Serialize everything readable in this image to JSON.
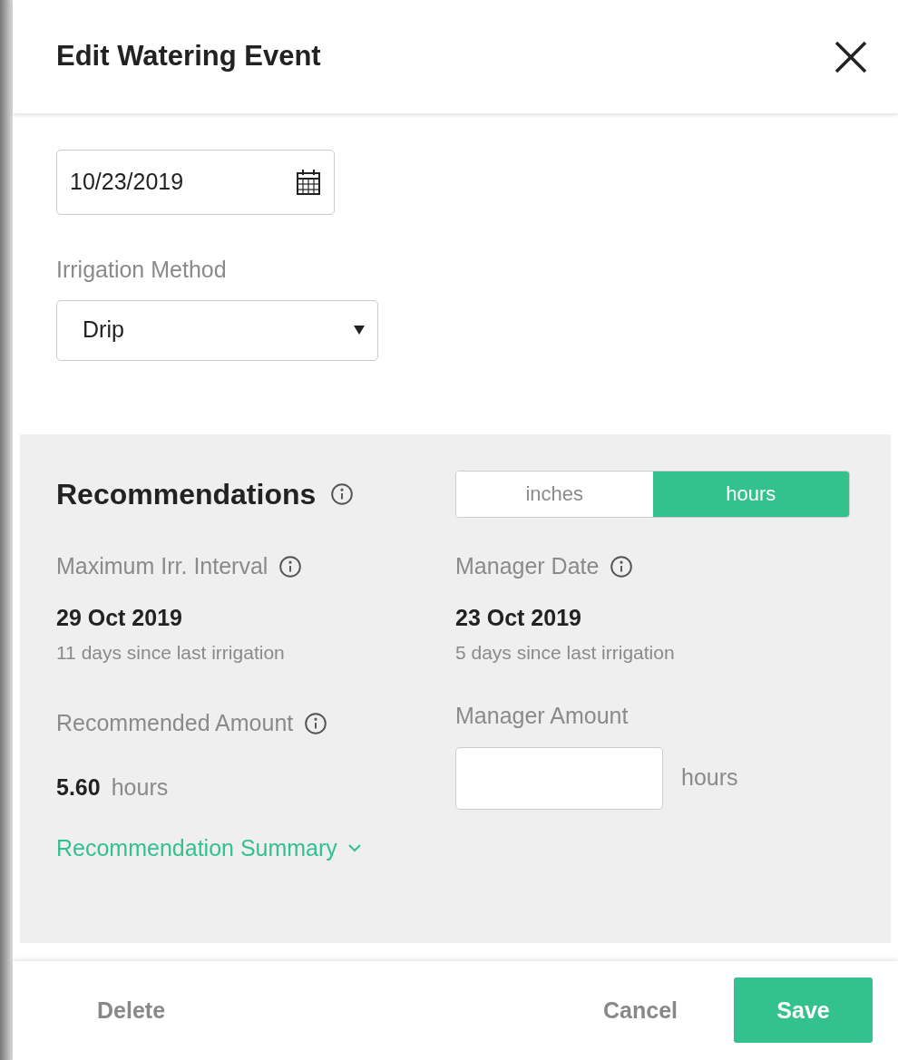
{
  "header": {
    "title": "Edit Watering Event"
  },
  "date_field": {
    "value": "10/23/2019"
  },
  "irrigation_method": {
    "label": "Irrigation Method",
    "value": "Drip"
  },
  "recommendations": {
    "title": "Recommendations",
    "unit_toggle": [
      {
        "label": "inches",
        "selected": false
      },
      {
        "label": "hours",
        "selected": true
      }
    ],
    "max_interval": {
      "label": "Maximum Irr. Interval",
      "date": "29 Oct 2019",
      "note": "11 days since last irrigation"
    },
    "manager_date": {
      "label": "Manager Date",
      "date": "23 Oct 2019",
      "note": "5 days since last irrigation"
    },
    "recommended_amount": {
      "label": "Recommended Amount",
      "value": "5.60",
      "unit": "hours"
    },
    "manager_amount": {
      "label": "Manager Amount",
      "unit": "hours"
    },
    "summary_link": {
      "label": "Recommendation Summary",
      "expanded": false
    }
  },
  "footer": {
    "delete": "Delete",
    "cancel": "Cancel",
    "save": "Save"
  }
}
